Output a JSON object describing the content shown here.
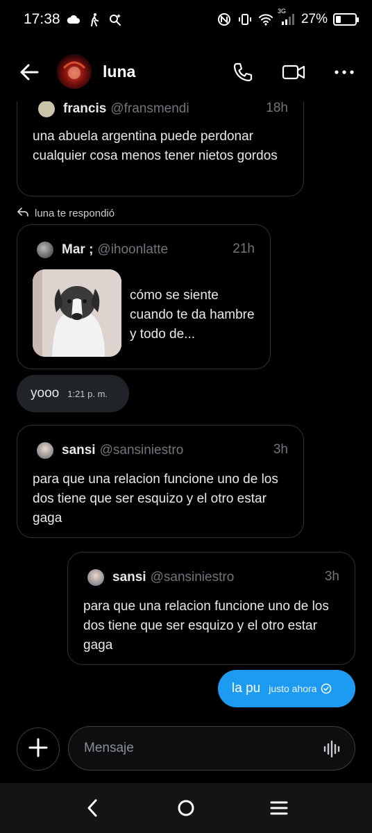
{
  "status_bar": {
    "time": "17:38",
    "battery_percent": "27%",
    "battery_level": 0.27,
    "network_label": "3G"
  },
  "header": {
    "contact_name": "luna"
  },
  "messages": {
    "top_card": {
      "name": "francis",
      "handle": "@fransmendi",
      "time": "18h",
      "text": "una abuela argentina puede perdonar cualquier cosa menos tener nietos gordos"
    },
    "reply_note": "luna te respondió",
    "quoted_card": {
      "name": "Mar ;",
      "handle": "@ihoonlatte",
      "time": "21h",
      "text": "cómo se siente cuando te da hambre y todo de..."
    },
    "received_bubble": {
      "text": "yooo",
      "time": "1:21 p. m."
    },
    "received_card": {
      "name": "sansi",
      "handle": "@sansiniestro",
      "time": "3h",
      "text": "para que una relacion funcione uno de los dos tiene que ser esquizo y el otro estar gaga"
    },
    "sent_card": {
      "name": "sansi",
      "handle": "@sansiniestro",
      "time": "3h",
      "text": "para que una relacion funcione uno de los dos tiene que ser esquizo y el otro estar gaga"
    },
    "sent_bubble": {
      "text": "la pu",
      "time": "justo ahora"
    }
  },
  "composer": {
    "placeholder": "Mensaje"
  },
  "colors": {
    "accent": "#1d9bf0",
    "background": "#000000",
    "border": "#2f3336",
    "muted_text": "#71767b"
  }
}
